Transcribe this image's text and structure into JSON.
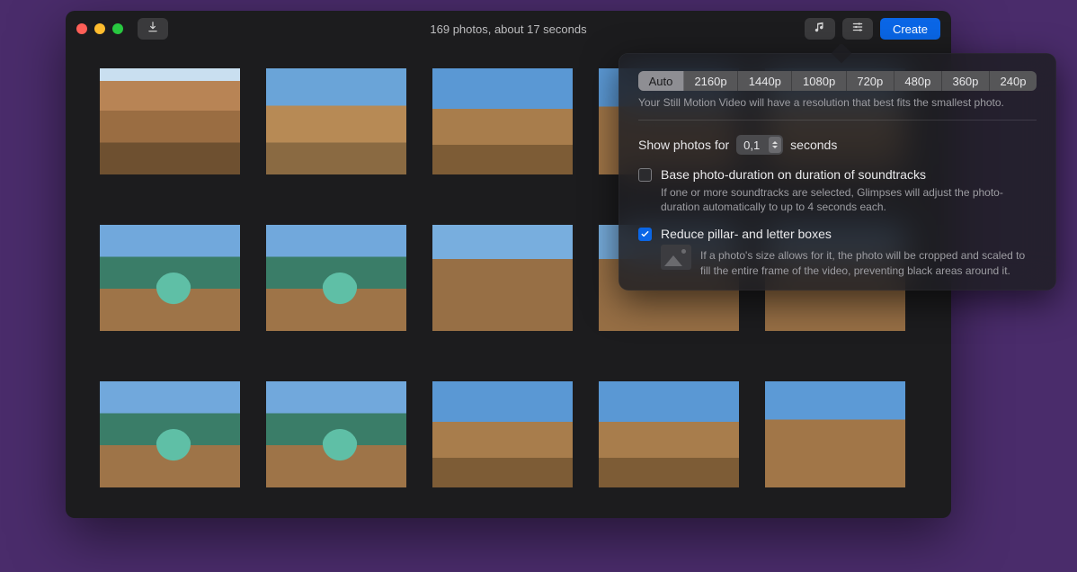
{
  "window": {
    "title": "169 photos, about 17 seconds"
  },
  "toolbar": {
    "create_label": "Create"
  },
  "popover": {
    "resolutions": [
      "Auto",
      "2160p",
      "1440p",
      "1080p",
      "720p",
      "480p",
      "360p",
      "240p"
    ],
    "resolution_selected_index": 0,
    "resolution_hint": "Your Still Motion Video will have a resolution that best fits the smallest photo.",
    "duration_prefix": "Show photos for",
    "duration_value": "0,1",
    "duration_suffix": "seconds",
    "base_on_soundtracks": {
      "checked": false,
      "label": "Base photo-duration on duration of soundtracks",
      "sub": "If one or more soundtracks are selected, Glimpses will adjust the photo-duration automatically to up to 4 seconds each."
    },
    "reduce_boxes": {
      "checked": true,
      "label": "Reduce pillar- and letter boxes",
      "sub": "If a photo's size allows for it, the photo will be cropped and scaled to fill the entire frame of the video, preventing black areas around it."
    }
  }
}
